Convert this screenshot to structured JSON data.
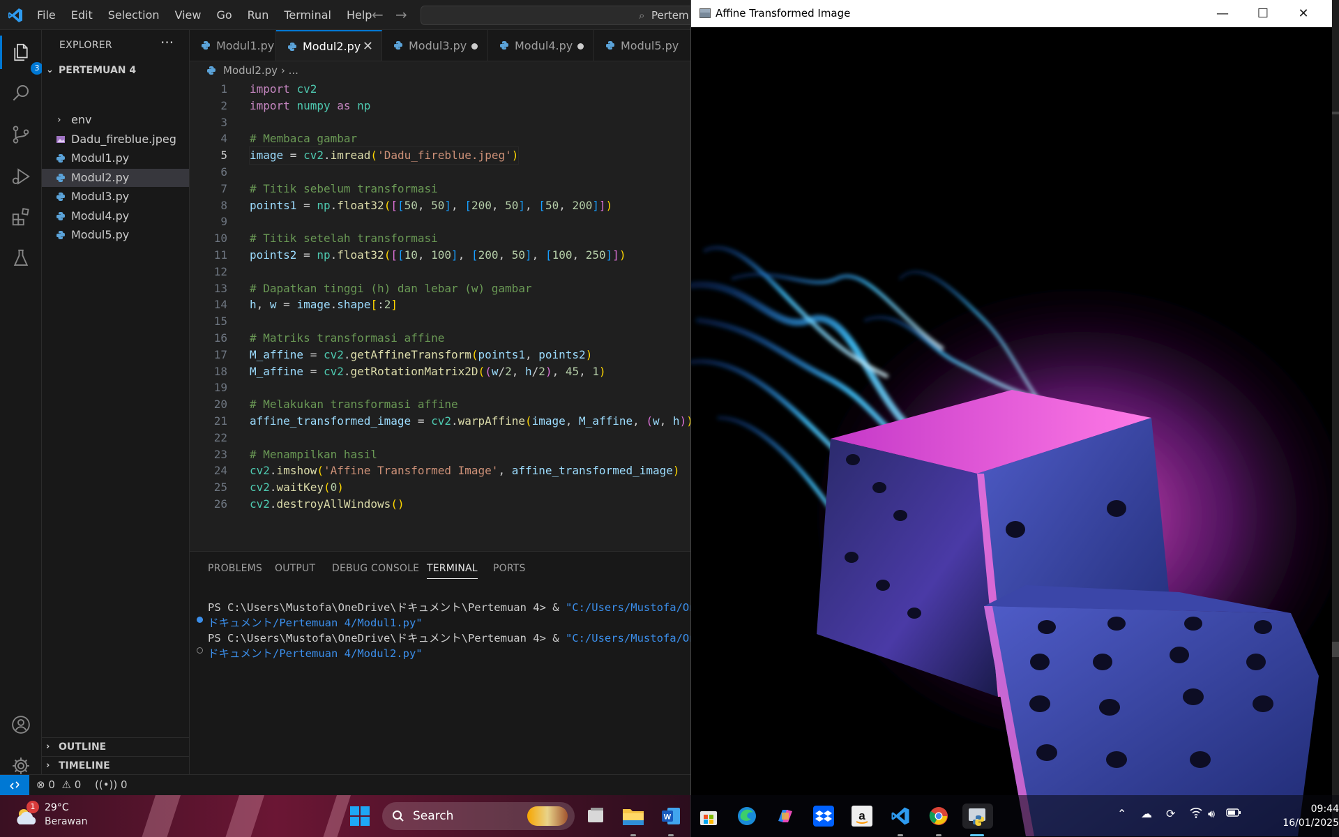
{
  "vscode": {
    "menu": [
      "File",
      "Edit",
      "Selection",
      "View",
      "Go",
      "Run",
      "Terminal",
      "Help"
    ],
    "command_center": "Pertem",
    "explorer_badge": "3",
    "explorer": {
      "title": "EXPLORER",
      "more": "···",
      "folder": "PERTEMUAN 4",
      "items": [
        {
          "name": "env",
          "type": "folder"
        },
        {
          "name": "Dadu_fireblue.jpeg",
          "type": "image"
        },
        {
          "name": "Modul1.py",
          "type": "py"
        },
        {
          "name": "Modul2.py",
          "type": "py",
          "selected": true
        },
        {
          "name": "Modul3.py",
          "type": "py"
        },
        {
          "name": "Modul4.py",
          "type": "py"
        },
        {
          "name": "Modul5.py",
          "type": "py"
        }
      ],
      "outline": "OUTLINE",
      "timeline": "TIMELINE"
    },
    "tabs": [
      {
        "label": "Modul1.py",
        "state": "clean"
      },
      {
        "label": "Modul2.py",
        "state": "active"
      },
      {
        "label": "Modul3.py",
        "state": "dirty"
      },
      {
        "label": "Modul4.py",
        "state": "dirty"
      },
      {
        "label": "Modul5.py",
        "state": "clean"
      }
    ],
    "breadcrumb": {
      "file": "Modul2.py",
      "rest": "..."
    },
    "current_line": 5,
    "code_lines": [
      [
        [
          "kw",
          "import"
        ],
        [
          "pn",
          " "
        ],
        [
          "mod",
          "cv2"
        ]
      ],
      [
        [
          "kw",
          "import"
        ],
        [
          "pn",
          " "
        ],
        [
          "mod",
          "numpy"
        ],
        [
          "pn",
          " "
        ],
        [
          "kw",
          "as"
        ],
        [
          "pn",
          " "
        ],
        [
          "mod",
          "np"
        ]
      ],
      [],
      [
        [
          "cm",
          "# Membaca gambar"
        ]
      ],
      [
        [
          "var",
          "image"
        ],
        [
          "pn",
          " = "
        ],
        [
          "mod",
          "cv2"
        ],
        [
          "pn",
          "."
        ],
        [
          "fn",
          "imread"
        ],
        [
          "b1",
          "("
        ],
        [
          "str",
          "'Dadu_fireblue.jpeg'"
        ],
        [
          "b1",
          ")"
        ]
      ],
      [],
      [
        [
          "cm",
          "# Titik sebelum transformasi"
        ]
      ],
      [
        [
          "var",
          "points1"
        ],
        [
          "pn",
          " = "
        ],
        [
          "mod",
          "np"
        ],
        [
          "pn",
          "."
        ],
        [
          "fn",
          "float32"
        ],
        [
          "b1",
          "("
        ],
        [
          "b2",
          "["
        ],
        [
          "b3",
          "["
        ],
        [
          "num",
          "50"
        ],
        [
          "pn",
          ", "
        ],
        [
          "num",
          "50"
        ],
        [
          "b3",
          "]"
        ],
        [
          "pn",
          ", "
        ],
        [
          "b3",
          "["
        ],
        [
          "num",
          "200"
        ],
        [
          "pn",
          ", "
        ],
        [
          "num",
          "50"
        ],
        [
          "b3",
          "]"
        ],
        [
          "pn",
          ", "
        ],
        [
          "b3",
          "["
        ],
        [
          "num",
          "50"
        ],
        [
          "pn",
          ", "
        ],
        [
          "num",
          "200"
        ],
        [
          "b3",
          "]"
        ],
        [
          "b2",
          "]"
        ],
        [
          "b1",
          ")"
        ]
      ],
      [],
      [
        [
          "cm",
          "# Titik setelah transformasi"
        ]
      ],
      [
        [
          "var",
          "points2"
        ],
        [
          "pn",
          " = "
        ],
        [
          "mod",
          "np"
        ],
        [
          "pn",
          "."
        ],
        [
          "fn",
          "float32"
        ],
        [
          "b1",
          "("
        ],
        [
          "b2",
          "["
        ],
        [
          "b3",
          "["
        ],
        [
          "num",
          "10"
        ],
        [
          "pn",
          ", "
        ],
        [
          "num",
          "100"
        ],
        [
          "b3",
          "]"
        ],
        [
          "pn",
          ", "
        ],
        [
          "b3",
          "["
        ],
        [
          "num",
          "200"
        ],
        [
          "pn",
          ", "
        ],
        [
          "num",
          "50"
        ],
        [
          "b3",
          "]"
        ],
        [
          "pn",
          ", "
        ],
        [
          "b3",
          "["
        ],
        [
          "num",
          "100"
        ],
        [
          "pn",
          ", "
        ],
        [
          "num",
          "250"
        ],
        [
          "b3",
          "]"
        ],
        [
          "b2",
          "]"
        ],
        [
          "b1",
          ")"
        ]
      ],
      [],
      [
        [
          "cm",
          "# Dapatkan tinggi (h) dan lebar (w) gambar"
        ]
      ],
      [
        [
          "var",
          "h"
        ],
        [
          "pn",
          ", "
        ],
        [
          "var",
          "w"
        ],
        [
          "pn",
          " = "
        ],
        [
          "var",
          "image"
        ],
        [
          "pn",
          "."
        ],
        [
          "var",
          "shape"
        ],
        [
          "b1",
          "["
        ],
        [
          "pn",
          ":"
        ],
        [
          "num",
          "2"
        ],
        [
          "b1",
          "]"
        ]
      ],
      [],
      [
        [
          "cm",
          "# Matriks transformasi affine"
        ]
      ],
      [
        [
          "var",
          "M_affine"
        ],
        [
          "pn",
          " = "
        ],
        [
          "mod",
          "cv2"
        ],
        [
          "pn",
          "."
        ],
        [
          "fn",
          "getAffineTransform"
        ],
        [
          "b1",
          "("
        ],
        [
          "var",
          "points1"
        ],
        [
          "pn",
          ", "
        ],
        [
          "var",
          "points2"
        ],
        [
          "b1",
          ")"
        ]
      ],
      [
        [
          "var",
          "M_affine"
        ],
        [
          "pn",
          " = "
        ],
        [
          "mod",
          "cv2"
        ],
        [
          "pn",
          "."
        ],
        [
          "fn",
          "getRotationMatrix2D"
        ],
        [
          "b1",
          "("
        ],
        [
          "b2",
          "("
        ],
        [
          "var",
          "w"
        ],
        [
          "pn",
          "/"
        ],
        [
          "num",
          "2"
        ],
        [
          "pn",
          ", "
        ],
        [
          "var",
          "h"
        ],
        [
          "pn",
          "/"
        ],
        [
          "num",
          "2"
        ],
        [
          "b2",
          ")"
        ],
        [
          "pn",
          ", "
        ],
        [
          "num",
          "45"
        ],
        [
          "pn",
          ", "
        ],
        [
          "num",
          "1"
        ],
        [
          "b1",
          ")"
        ]
      ],
      [],
      [
        [
          "cm",
          "# Melakukan transformasi affine"
        ]
      ],
      [
        [
          "var",
          "affine_transformed_image"
        ],
        [
          "pn",
          " = "
        ],
        [
          "mod",
          "cv2"
        ],
        [
          "pn",
          "."
        ],
        [
          "fn",
          "warpAffine"
        ],
        [
          "b1",
          "("
        ],
        [
          "var",
          "image"
        ],
        [
          "pn",
          ", "
        ],
        [
          "var",
          "M_affine"
        ],
        [
          "pn",
          ", "
        ],
        [
          "b2",
          "("
        ],
        [
          "var",
          "w"
        ],
        [
          "pn",
          ", "
        ],
        [
          "var",
          "h"
        ],
        [
          "b2",
          ")"
        ],
        [
          "b1",
          ")"
        ]
      ],
      [],
      [
        [
          "cm",
          "# Menampilkan hasil"
        ]
      ],
      [
        [
          "mod",
          "cv2"
        ],
        [
          "pn",
          "."
        ],
        [
          "fn",
          "imshow"
        ],
        [
          "b1",
          "("
        ],
        [
          "str",
          "'Affine Transformed Image'"
        ],
        [
          "pn",
          ", "
        ],
        [
          "var",
          "affine_transformed_image"
        ],
        [
          "b1",
          ")"
        ]
      ],
      [
        [
          "mod",
          "cv2"
        ],
        [
          "pn",
          "."
        ],
        [
          "fn",
          "waitKey"
        ],
        [
          "b1",
          "("
        ],
        [
          "num",
          "0"
        ],
        [
          "b1",
          ")"
        ]
      ],
      [
        [
          "mod",
          "cv2"
        ],
        [
          "pn",
          "."
        ],
        [
          "fn",
          "destroyAllWindows"
        ],
        [
          "b1",
          "("
        ],
        [
          "b1",
          ")"
        ]
      ]
    ],
    "panel_tabs": [
      "PROBLEMS",
      "OUTPUT",
      "DEBUG CONSOLE",
      "TERMINAL",
      "PORTS"
    ],
    "active_panel_tab": "TERMINAL",
    "terminal": [
      {
        "prompt": "PS C:\\Users\\Mustofa\\OneDrive\\ドキュメント\\Pertemuan 4> & ",
        "path1": "\"C:/Users/Mustofa/On",
        "path2": "ドキュメント/Pertemuan 4/Modul1.py\"",
        "status": "success"
      },
      {
        "prompt": "PS C:\\Users\\Mustofa\\OneDrive\\ドキュメント\\Pertemuan 4> & ",
        "path1": "\"C:/Users/Mustofa/On",
        "path2": "ドキュメント/Pertemuan 4/Modul2.py\"",
        "status": "running"
      }
    ],
    "status": {
      "errors": "0",
      "warnings": "0",
      "ports": "0"
    }
  },
  "image_window": {
    "title": "Affine Transformed Image"
  },
  "taskbar": {
    "weather": {
      "temp": "29°C",
      "desc": "Berawan",
      "alert": "1"
    },
    "search": "Search",
    "pinned": [
      "microsoft-store",
      "edge",
      "copilot",
      "dropbox",
      "amazon",
      "vscode",
      "chrome",
      "python"
    ],
    "clock": {
      "time": "09:44",
      "date": "16/01/2025"
    }
  },
  "colors": {
    "accent": "#0078d4",
    "editor_bg": "#1f1f1f",
    "sidebar_bg": "#181818"
  }
}
